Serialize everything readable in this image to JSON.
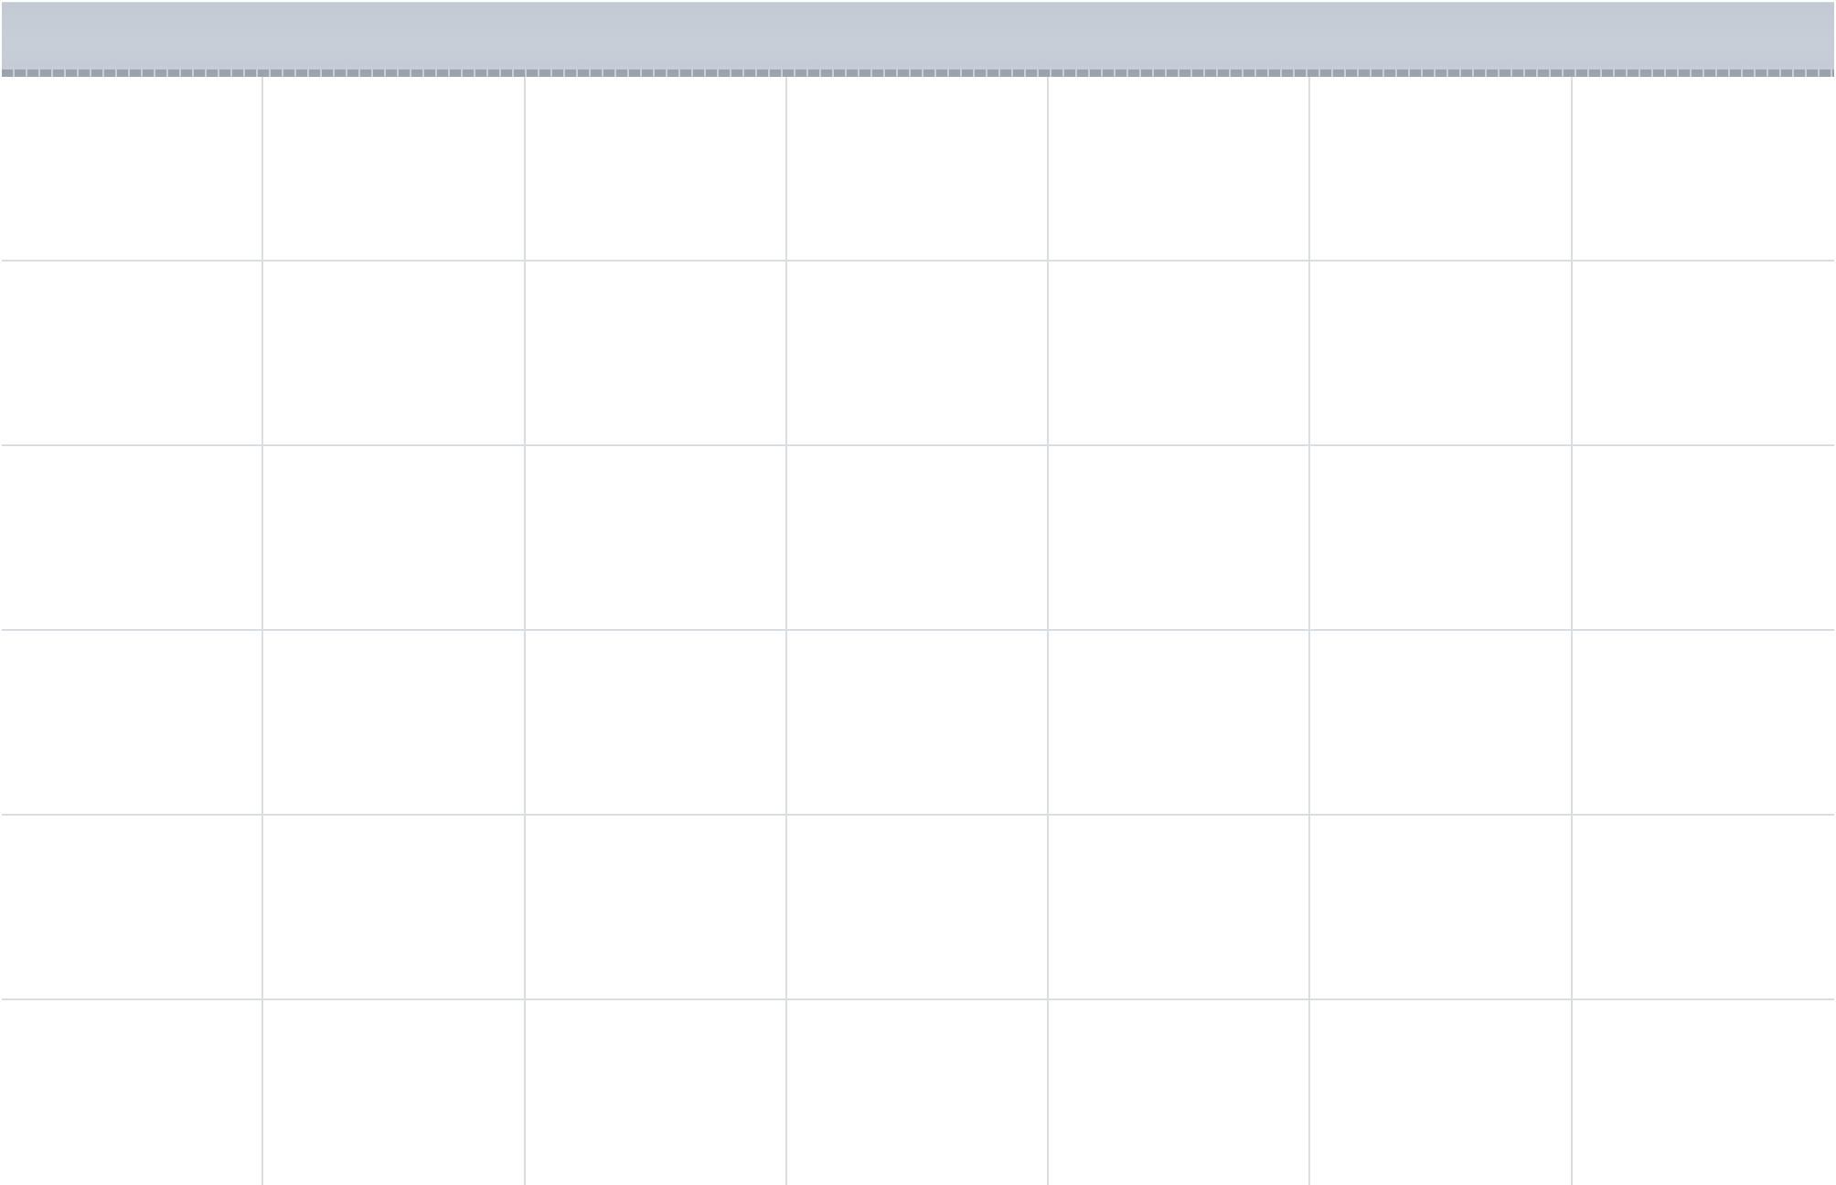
{
  "calendar": {
    "header_title": "",
    "colors": {
      "header_bg": "#c6ccd5",
      "ruler_dark": "#9aa3ad",
      "grid_line": "#d9dde2",
      "cell_bg": "#ffffff"
    },
    "columns": 7,
    "rows": 6,
    "cells": [
      "",
      "",
      "",
      "",
      "",
      "",
      "",
      "",
      "",
      "",
      "",
      "",
      "",
      "",
      "",
      "",
      "",
      "",
      "",
      "",
      "",
      "",
      "",
      "",
      "",
      "",
      "",
      "",
      "",
      "",
      "",
      "",
      "",
      "",
      "",
      "",
      "",
      "",
      "",
      "",
      "",
      ""
    ]
  }
}
